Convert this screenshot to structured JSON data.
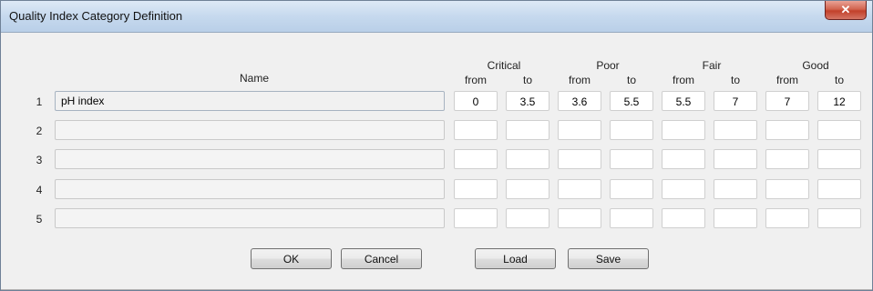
{
  "window": {
    "title": "Quality Index Category Definition",
    "close_glyph": "✕"
  },
  "table": {
    "name_header": "Name",
    "category_headers": [
      "Critical",
      "Poor",
      "Fair",
      "Good"
    ],
    "sub_headers": [
      "from",
      "to",
      "from",
      "to",
      "from",
      "to",
      "from",
      "to"
    ],
    "rows": [
      {
        "num": "1",
        "name": "pH index",
        "values": [
          "0",
          "3.5",
          "3.6",
          "5.5",
          "5.5",
          "7",
          "7",
          "12"
        ]
      },
      {
        "num": "2",
        "name": "",
        "values": [
          "",
          "",
          "",
          "",
          "",
          "",
          "",
          ""
        ]
      },
      {
        "num": "3",
        "name": "",
        "values": [
          "",
          "",
          "",
          "",
          "",
          "",
          "",
          ""
        ]
      },
      {
        "num": "4",
        "name": "",
        "values": [
          "",
          "",
          "",
          "",
          "",
          "",
          "",
          ""
        ]
      },
      {
        "num": "5",
        "name": "",
        "values": [
          "",
          "",
          "",
          "",
          "",
          "",
          "",
          ""
        ]
      }
    ]
  },
  "buttons": {
    "ok": "OK",
    "cancel": "Cancel",
    "load": "Load",
    "save": "Save"
  }
}
